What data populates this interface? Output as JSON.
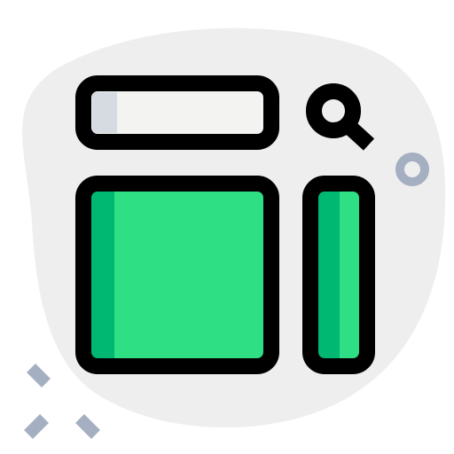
{
  "icon": {
    "name": "web-layout-search-icon",
    "parts": [
      "background-blob",
      "search-bar",
      "search-magnifier-icon",
      "main-content-panel",
      "side-panel",
      "decorative-ring",
      "decorative-sparkle-dashes"
    ]
  },
  "colors": {
    "background_blob": "#EEEEEE",
    "outline": "#000000",
    "search_bar_fill": "#F3F3F1",
    "search_bar_shade": "#D5DBE1",
    "panel_fill": "#2FDF84",
    "panel_shade": "#00B871",
    "decoration": "#A4AFC1"
  }
}
